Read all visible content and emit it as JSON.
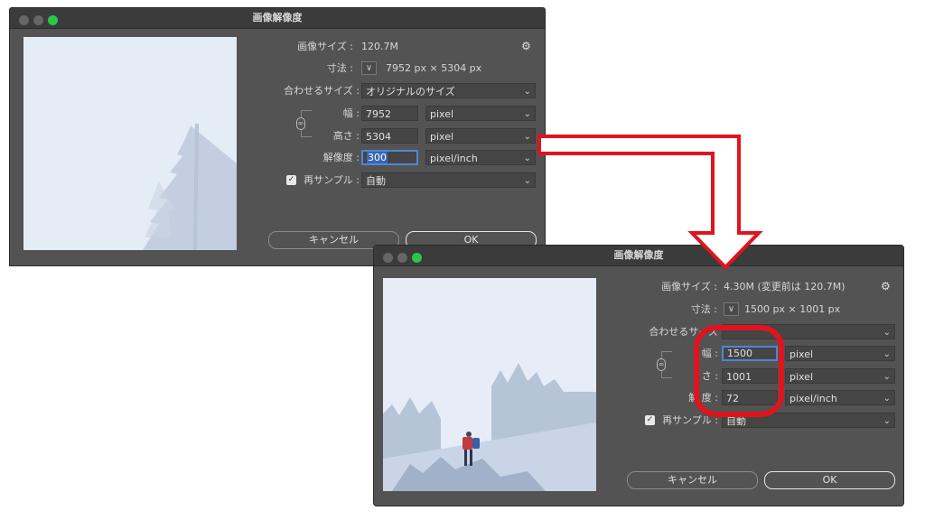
{
  "dialog_before": {
    "title": "画像解像度",
    "image_size_label": "画像サイズ :",
    "image_size_value": "120.7M",
    "dimensions_label": "寸法 :",
    "dimensions_value": "7952 px × 5304 px",
    "fit_to_label": "合わせるサイズ :",
    "fit_to_value": "オリジナルのサイズ",
    "width_label": "幅 :",
    "width_value": "7952",
    "width_unit": "pixel",
    "height_label": "高さ :",
    "height_value": "5304",
    "height_unit": "pixel",
    "resolution_label": "解像度 :",
    "resolution_value": "300",
    "resolution_unit": "pixel/inch",
    "resample_label": "再サンプル :",
    "resample_value": "自動",
    "resample_checked": true,
    "cancel_label": "キャンセル",
    "ok_label": "OK"
  },
  "dialog_after": {
    "title": "画像解像度",
    "image_size_label": "画像サイズ :",
    "image_size_value": "4.30M (変更前は 120.7M)",
    "dimensions_label": "寸法 :",
    "dimensions_value": "1500 px × 1001 px",
    "fit_to_label": "合わせるサイズ",
    "fit_to_value": "",
    "width_label": "幅 :",
    "width_value": "1500",
    "width_unit": "pixel",
    "height_label": "さ :",
    "height_value": "1001",
    "height_unit": "pixel",
    "resolution_label": "解 度 :",
    "resolution_value": "72",
    "resolution_unit": "pixel/inch",
    "resample_label": "再サンプル :",
    "resample_value": "自動",
    "resample_checked": true,
    "cancel_label": "キャンセル",
    "ok_label": "OK"
  },
  "icons": {
    "gear": "gear-icon",
    "chevron": "chevron-down-icon",
    "link": "link-icon",
    "checkbox": "checkmark-icon"
  },
  "colors": {
    "dialog_bg": "#535353",
    "titlebar_bg": "#3b3b3b",
    "focus_blue": "#4f86d6",
    "annotation_red": "#e0141e",
    "traffic_green": "#2ac64a"
  }
}
